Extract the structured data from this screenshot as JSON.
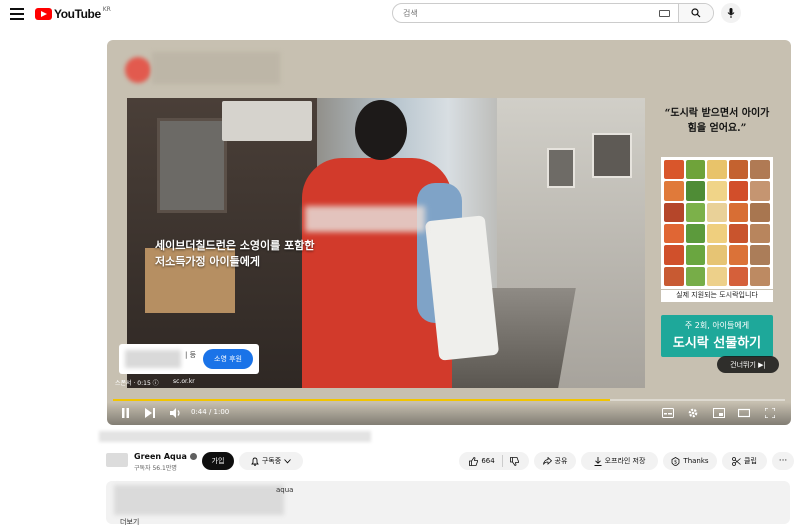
{
  "header": {
    "logo_text": "YouTube",
    "region": "KR",
    "search_placeholder": "검색"
  },
  "ad": {
    "caption_line1": "세이브더칠드런은 소영이를 포함한",
    "caption_line2": "저소득가정 아이들에게",
    "brand_suffix": "| 등",
    "cta_label": "소영 후원",
    "sponsor_label": "스폰서 · 0:15 ⓘ",
    "url": "sc.or.kr",
    "promo_quote": "“도시락 받으면서 아이가 힘을 얻어요.”",
    "promo_caption": "실제 지원되는 도시락입니다",
    "promo_sub": "주 2회, 아이들에게",
    "promo_main": "도시락 선물하기",
    "skip_label": "건너뛰기 ▶|"
  },
  "player": {
    "time": "0:44 / 1:00",
    "progress": 0.74,
    "progress_color": "#f2c400"
  },
  "channel": {
    "name": "Green Aqua",
    "subscribers": "구독자 56.1만명",
    "join_label": "가입",
    "subscribe_label": "구독중"
  },
  "actions": {
    "likes": "664",
    "share_label": "공유",
    "offline_label": "오프라인 저장",
    "thanks_label": "Thanks",
    "clip_label": "클립"
  },
  "description": {
    "suffix": "aqua",
    "more_label": "더보기"
  }
}
